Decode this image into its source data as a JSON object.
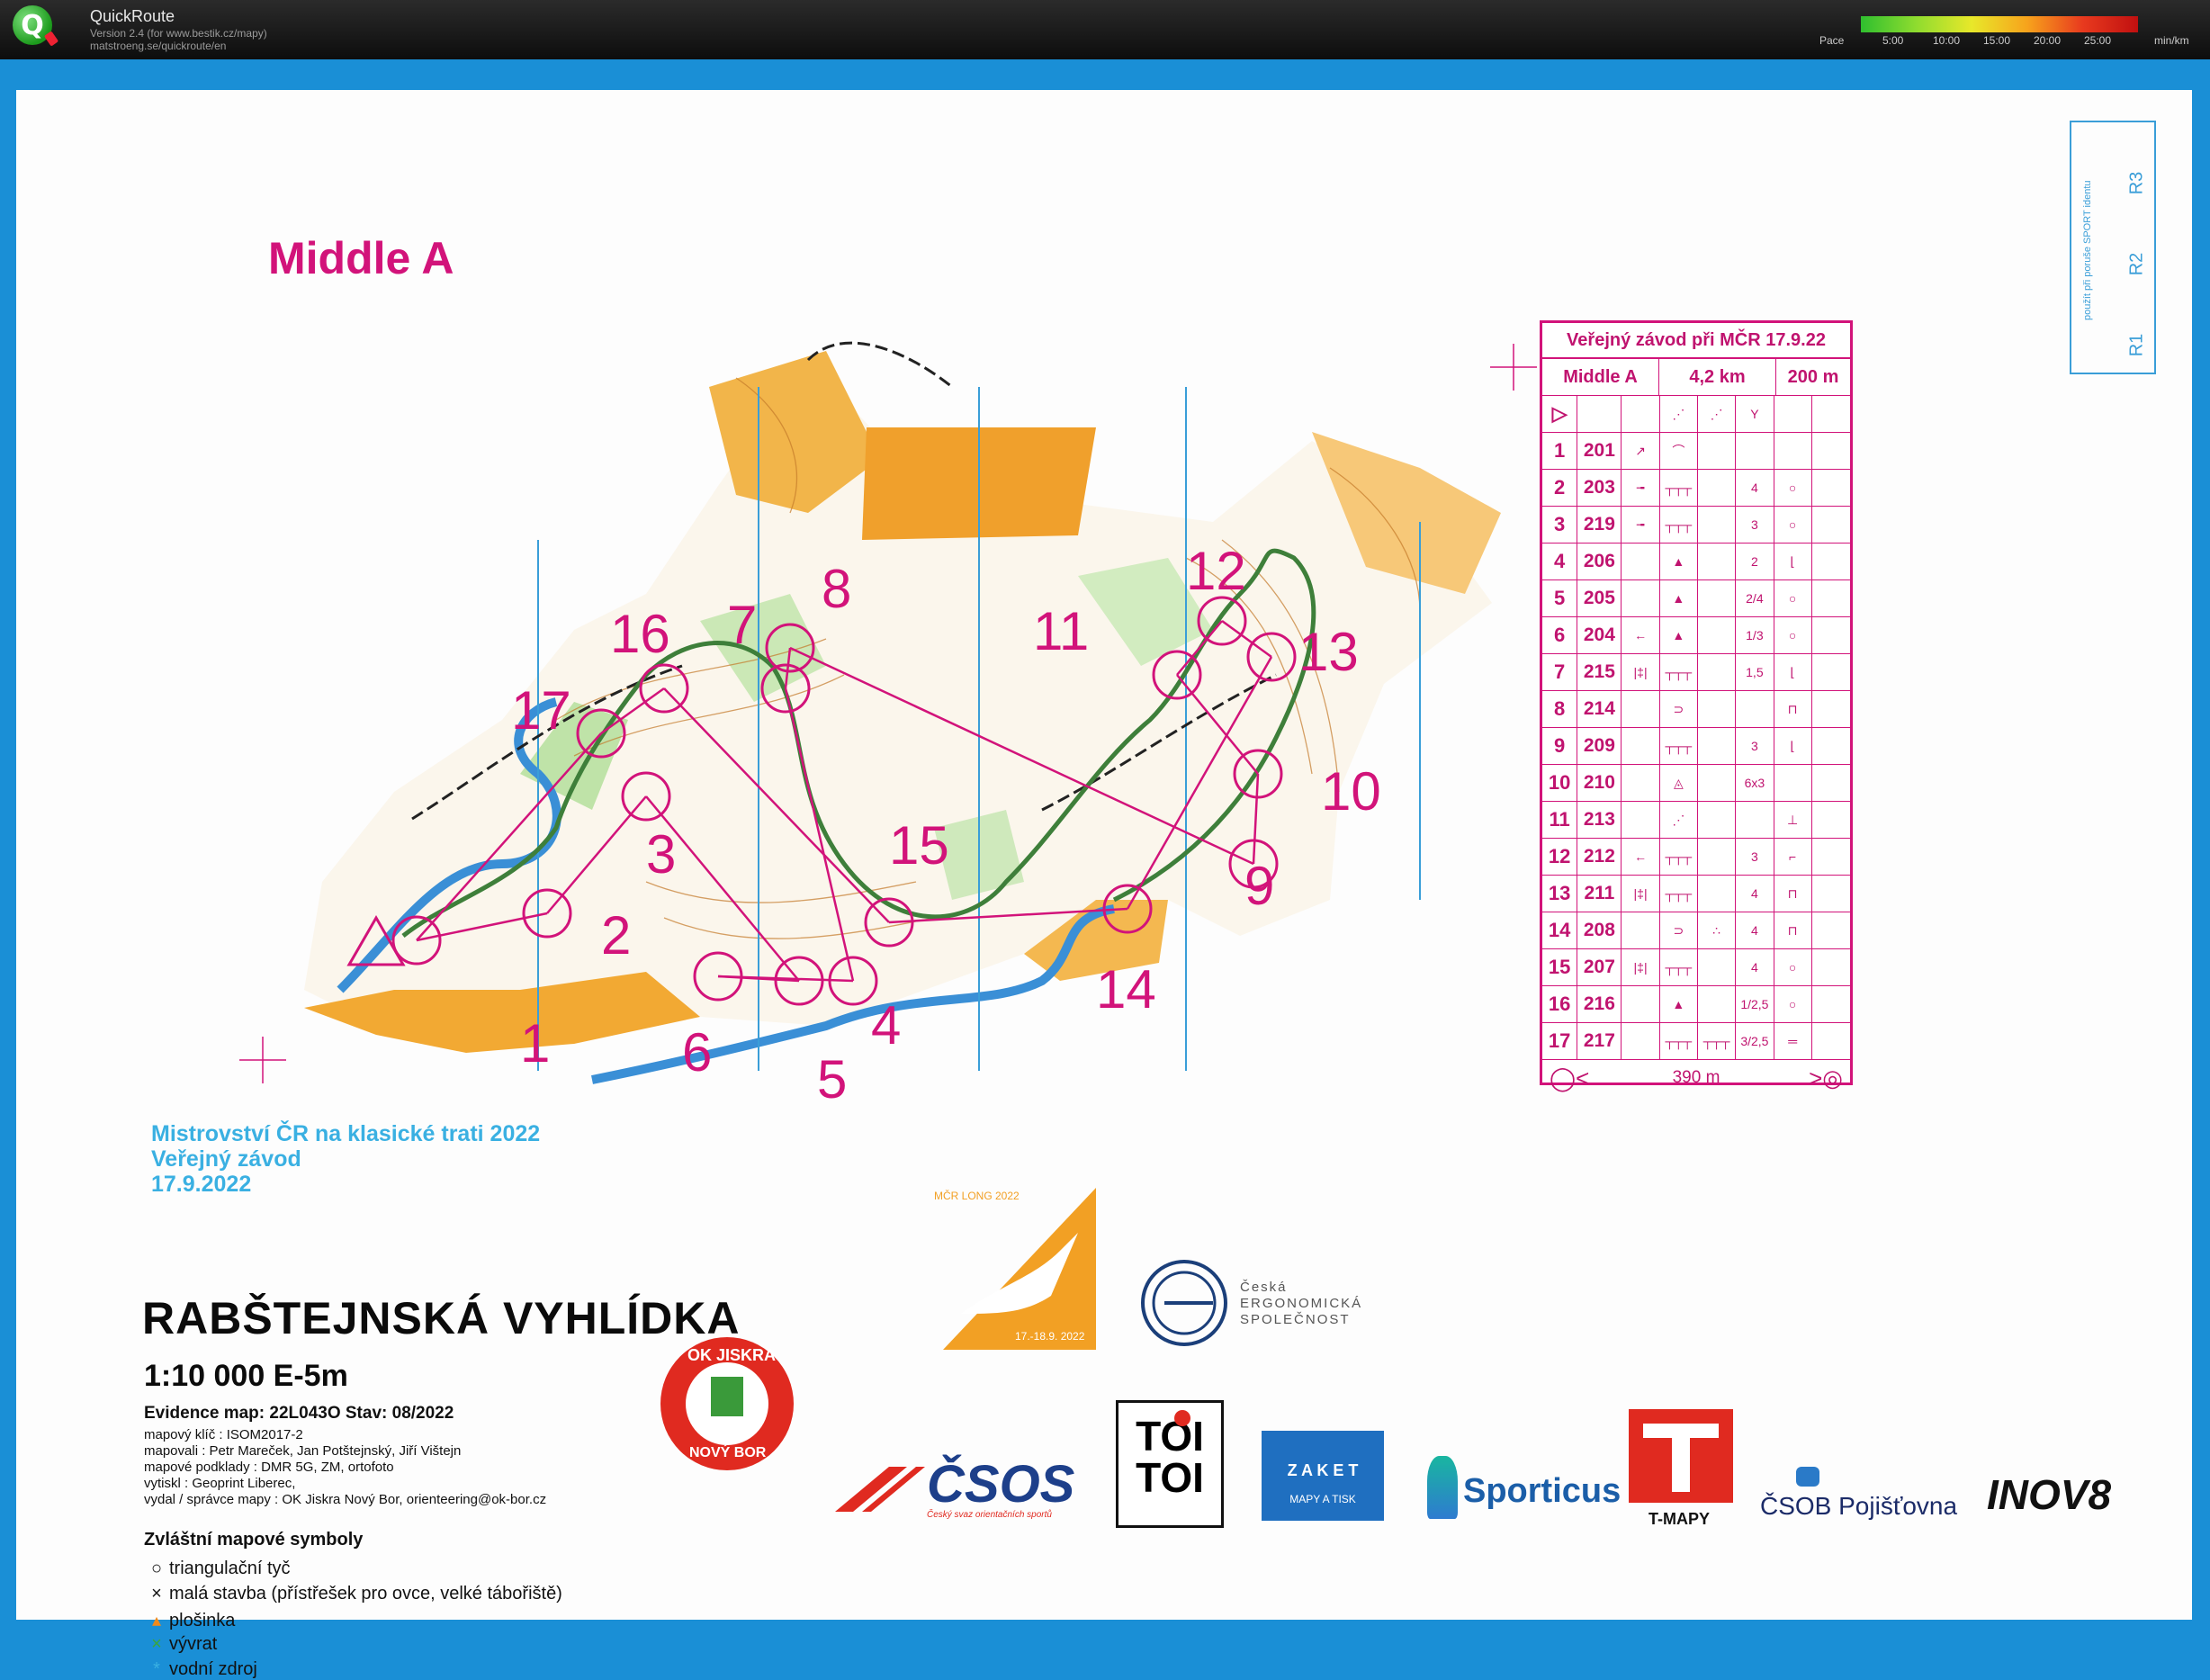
{
  "app": {
    "title": "QuickRoute",
    "version_line": "Version 2.4  (for www.bestik.cz/mapy)",
    "url_line": "matstroeng.se/quickroute/en",
    "icon_letter": "Q"
  },
  "pace": {
    "label": "Pace",
    "ticks": [
      "5:00",
      "10:00",
      "15:00",
      "20:00",
      "25:00"
    ],
    "unit": "min/km"
  },
  "map": {
    "course_title": "Middle A",
    "control_numbers": [
      "1",
      "2",
      "3",
      "4",
      "5",
      "6",
      "7",
      "8",
      "9",
      "10",
      "11",
      "12",
      "13",
      "14",
      "15",
      "16",
      "17"
    ],
    "rbox": {
      "note": "použít při poruše SPORT identu",
      "labels": [
        "R1",
        "R2",
        "R3"
      ]
    }
  },
  "description_sheet": {
    "header": "Veřejný závod při MČR 17.9.22",
    "course": "Middle A",
    "length": "4,2 km",
    "climb": "200 m",
    "rows": [
      {
        "n": "1",
        "code": "201",
        "d": "↗",
        "e": "⌒",
        "f": "",
        "g": "",
        "h": ""
      },
      {
        "n": "2",
        "code": "203",
        "d": "╼",
        "e": "┬┬┬",
        "f": "",
        "g": "4",
        "h": "○"
      },
      {
        "n": "3",
        "code": "219",
        "d": "╼",
        "e": "┬┬┬",
        "f": "",
        "g": "3",
        "h": "○"
      },
      {
        "n": "4",
        "code": "206",
        "d": "",
        "e": "▲",
        "f": "",
        "g": "2",
        "h": "⌊"
      },
      {
        "n": "5",
        "code": "205",
        "d": "",
        "e": "▲",
        "f": "",
        "g": "2/4",
        "h": "○"
      },
      {
        "n": "6",
        "code": "204",
        "d": "←",
        "e": "▲",
        "f": "",
        "g": "1/3",
        "h": "○"
      },
      {
        "n": "7",
        "code": "215",
        "d": "|‡|",
        "e": "┬┬┬",
        "f": "",
        "g": "1,5",
        "h": "⌊"
      },
      {
        "n": "8",
        "code": "214",
        "d": "",
        "e": "⊃",
        "f": "",
        "g": "",
        "h": "⊓"
      },
      {
        "n": "9",
        "code": "209",
        "d": "",
        "e": "┬┬┬",
        "f": "",
        "g": "3",
        "h": "⌊"
      },
      {
        "n": "10",
        "code": "210",
        "d": "",
        "e": "◬",
        "f": "",
        "g": "6x3",
        "h": ""
      },
      {
        "n": "11",
        "code": "213",
        "d": "",
        "e": "⋰",
        "f": "",
        "g": "",
        "h": "⊥"
      },
      {
        "n": "12",
        "code": "212",
        "d": "←",
        "e": "┬┬┬",
        "f": "",
        "g": "3",
        "h": "⌐"
      },
      {
        "n": "13",
        "code": "211",
        "d": "|‡|",
        "e": "┬┬┬",
        "f": "",
        "g": "4",
        "h": "⊓"
      },
      {
        "n": "14",
        "code": "208",
        "d": "",
        "e": "⊃",
        "f": "∴",
        "g": "4",
        "h": "⊓"
      },
      {
        "n": "15",
        "code": "207",
        "d": "|‡|",
        "e": "┬┬┬",
        "f": "",
        "g": "4",
        "h": "○"
      },
      {
        "n": "16",
        "code": "216",
        "d": "",
        "e": "▲",
        "f": "",
        "g": "1/2,5",
        "h": "○"
      },
      {
        "n": "17",
        "code": "217",
        "d": "",
        "e": "┬┬┬",
        "f": "┬┬┬",
        "g": "3/2,5",
        "h": "═"
      }
    ],
    "finish": "390 m"
  },
  "info": {
    "event_line1": "Mistrovství ČR na klasické trati 2022",
    "event_line2": "Veřejný závod",
    "event_line3": "17.9.2022",
    "map_name": "RABŠTEJNSKÁ VYHLÍDKA",
    "scale": "1:10 000  E-5m",
    "evidence": "Evidence map: 22L043O  Stav: 08/2022",
    "credits": [
      "mapový klíč : ISOM2017-2",
      "mapovali : Petr Mareček, Jan Potštejnský, Jiří Vištejn",
      "mapové podklady : DMR 5G, ZM, ortofoto",
      "vytiskl : Geoprint Liberec,",
      "vydal / správce mapy : OK Jiskra Nový Bor,  orienteering@ok-bor.cz"
    ],
    "legend_title": "Zvláštní mapové symboly",
    "legend": [
      {
        "sym": "○",
        "color": "#111111",
        "text": "triangulační tyč"
      },
      {
        "sym": "×",
        "color": "#111111",
        "text": "malá stavba (přístřešek pro ovce, velké tábořiště)"
      },
      {
        "sym": "▴",
        "color": "#f08a1c",
        "text": "plošinka"
      },
      {
        "sym": "×",
        "color": "#3aa63a",
        "text": "vývrat"
      },
      {
        "sym": "*",
        "color": "#3ab0e2",
        "text": "vodní zdroj"
      }
    ]
  },
  "sponsors": {
    "mcr_logo_top": "MČR LONG 2022",
    "mcr_logo_bottom": "17.-18.9. 2022",
    "ergo": [
      "Česká",
      "ERGONOMICKÁ",
      "SPOLEČNOST"
    ],
    "okjiskra_top": "OK JISKRA",
    "okjiskra_bottom": "NOVÝ BOR",
    "csos": "ČSOS",
    "csos_sub": "Český svaz orientačních sportů",
    "toitoi": [
      "TOI",
      "TOI"
    ],
    "zaket": [
      "Z A K E T",
      "MAPY A TISK"
    ],
    "sporticus": "Sporticus",
    "tmapy": "T-MAPY",
    "csob": "ČSOB Pojišťovna",
    "inov": "INOV8"
  }
}
